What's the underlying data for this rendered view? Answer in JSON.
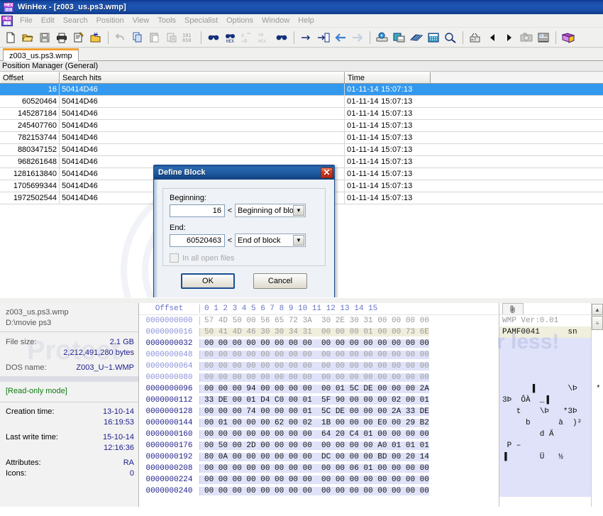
{
  "window": {
    "title": "WinHex - [z003_us.ps3.wmp]",
    "app_icon": "hex-app-icon"
  },
  "menu": {
    "items": [
      "File",
      "Edit",
      "Search",
      "Position",
      "View",
      "Tools",
      "Specialist",
      "Options",
      "Window",
      "Help"
    ]
  },
  "toolbar": {
    "groups": [
      [
        "new-file-icon",
        "open-folder-icon",
        "save-disk-icon",
        "print-icon",
        "properties-icon",
        "open-disk-icon"
      ],
      [
        "undo-icon",
        "copy-icon",
        "paste-icon",
        "clipboard-data-icon",
        "binary-101-icon"
      ],
      [
        "find-text-icon",
        "find-hex-icon",
        "replace-text-icon",
        "replace-hex-icon",
        "find-all-icon"
      ],
      [
        "goto-icon",
        "goto-file-icon",
        "back-arrow-icon",
        "forward-arrow-icon"
      ],
      [
        "open-disk-edit-icon",
        "save-backup-icon",
        "ram-editor-icon",
        "calculator-icon",
        "analyze-icon"
      ],
      [
        "checksum-icon",
        "prev-icon",
        "next-icon",
        "snapshot-icon",
        "report-icon"
      ],
      [
        "help-book-icon"
      ]
    ]
  },
  "document_tab": {
    "label": "z003_us.ps3.wmp"
  },
  "position_manager": {
    "title": "Position Manager (General)",
    "columns": [
      "Offset",
      "Search hits",
      "Time"
    ],
    "rows": [
      {
        "offset": "16",
        "hit": "50414D46",
        "time": "01-11-14  15:07:13",
        "selected": true
      },
      {
        "offset": "60520464",
        "hit": "50414D46",
        "time": "01-11-14  15:07:13",
        "selected": false
      },
      {
        "offset": "145287184",
        "hit": "50414D46",
        "time": "01-11-14  15:07:13",
        "selected": false
      },
      {
        "offset": "245407760",
        "hit": "50414D46",
        "time": "01-11-14  15:07:13",
        "selected": false
      },
      {
        "offset": "782153744",
        "hit": "50414D46",
        "time": "01-11-14  15:07:13",
        "selected": false
      },
      {
        "offset": "880347152",
        "hit": "50414D46",
        "time": "01-11-14  15:07:13",
        "selected": false
      },
      {
        "offset": "968261648",
        "hit": "50414D46",
        "time": "01-11-14  15:07:13",
        "selected": false
      },
      {
        "offset": "1281613840",
        "hit": "50414D46",
        "time": "01-11-14  15:07:13",
        "selected": false
      },
      {
        "offset": "1705699344",
        "hit": "50414D46",
        "time": "01-11-14  15:07:13",
        "selected": false
      },
      {
        "offset": "1972502544",
        "hit": "50414D46",
        "time": "01-11-14  15:07:13",
        "selected": false
      }
    ]
  },
  "dialog": {
    "title": "Define Block",
    "close_glyph": "✕",
    "beginning_label": "Beginning:",
    "beginning_value": "16",
    "beginning_relation": "<",
    "beginning_mode": "Beginning of bloc",
    "end_label": "End:",
    "end_value": "60520463",
    "end_relation": "<",
    "end_mode": "End of block",
    "checkbox_label": "In all open files",
    "checkbox_checked": false,
    "ok_label": "OK",
    "cancel_label": "Cancel",
    "caret_glyph": "▼"
  },
  "info_panel": {
    "file_name": "z003_us.ps3.wmp",
    "file_path": "D:\\movie ps3",
    "file_size_label": "File size:",
    "file_size_value": "2.1 GB",
    "file_size_bytes": "2,212,491,280 bytes",
    "dos_name_label": "DOS name:",
    "dos_name_value": "Z003_U~1.WMP",
    "mode": "[Read-only mode]",
    "creation_label": "Creation time:",
    "creation_date": "13-10-14",
    "creation_time": "16:19:53",
    "lastwrite_label": "Last write time:",
    "lastwrite_date": "15-10-14",
    "lastwrite_time": "12:16:36",
    "attributes_label": "Attributes:",
    "attributes_value": "RA",
    "icons_label": "Icons:",
    "icons_value": "0"
  },
  "hex_view": {
    "offset_header": "Offset",
    "column_header": " 0  1  2  3  4  5  6  7   8  9 10 11 12 13 14 15",
    "ascii_tab_icon": "paperclip-icon",
    "rows": [
      {
        "offset": "0000000000",
        "hex": "57 4D 50 00 56 65 72 3A  30 2E 30 31 00 00 00 00",
        "ascii": "WMP Ver:0.01",
        "style": "grey"
      },
      {
        "offset": "0000000016",
        "hex": "50 41 4D 46 30 30 34 31  00 00 00 01 00 00 73 6E",
        "ascii": "PAMF0041      sn",
        "style": "hl"
      },
      {
        "offset": "0000000032",
        "hex": "00 00 00 00 00 00 00 00  00 00 00 00 00 00 00 00",
        "ascii": "",
        "style": "dark-sel"
      },
      {
        "offset": "0000000048",
        "hex": "00 00 00 00 00 00 00 00  00 00 00 00 00 00 00 00",
        "ascii": "",
        "style": "grey-sel"
      },
      {
        "offset": "0000000064",
        "hex": "00 00 00 00 00 00 00 00  00 00 00 00 00 00 00 00",
        "ascii": "",
        "style": "grey-sel"
      },
      {
        "offset": "0000000080",
        "hex": "00 00 00 00 00 00 00 00  00 00 00 00 00 00 00 00",
        "ascii": "",
        "style": "grey-sel"
      },
      {
        "offset": "0000000096",
        "hex": "00 00 00 94 00 00 00 00  00 01 5C DE 00 00 00 2A",
        "ascii": "      ▐       \\Þ    *",
        "style": "dark-sel"
      },
      {
        "offset": "0000000112",
        "hex": "33 DE 00 01 D4 C0 00 01  5F 90 00 00 00 02 00 01",
        "ascii": "3Þ  ÔÀ  _▐",
        "style": "dark-sel"
      },
      {
        "offset": "0000000128",
        "hex": "00 00 00 74 00 00 00 01  5C DE 00 00 00 2A 33 DE",
        "ascii": "   t    \\Þ   *3Þ",
        "style": "dark-sel"
      },
      {
        "offset": "0000000144",
        "hex": "00 01 00 00 00 62 00 02  1B 00 00 00 E0 00 29 B2",
        "ascii": "     b      à  )²",
        "style": "dark-sel"
      },
      {
        "offset": "0000000160",
        "hex": "00 00 00 00 00 00 00 00  64 20 C4 01 00 00 00 00",
        "ascii": "        d Ä",
        "style": "dark-sel"
      },
      {
        "offset": "0000000176",
        "hex": "00 50 00 2D 00 00 00 00  00 00 00 00 A0 01 01 01",
        "ascii": " P –",
        "style": "dark-sel"
      },
      {
        "offset": "0000000192",
        "hex": "80 0A 00 00 00 00 00 00  DC 00 00 00 BD 00 20 14",
        "ascii": "▐       Ü   ½",
        "style": "dark-sel"
      },
      {
        "offset": "0000000208",
        "hex": "00 00 00 00 00 00 00 00  00 00 06 01 00 00 00 00",
        "ascii": "",
        "style": "dark-sel"
      },
      {
        "offset": "0000000224",
        "hex": "00 00 00 00 00 00 00 00  00 00 00 00 00 00 00 00",
        "ascii": "",
        "style": "dark-sel"
      },
      {
        "offset": "0000000240",
        "hex": "00 00 00 00 00 00 00 00  00 00 00 00 00 00 00 00",
        "ascii": "",
        "style": "dark-sel"
      }
    ]
  },
  "scrollbar": {
    "up_glyph": "▲",
    "thumb_glyph": "≡"
  },
  "watermarks": {
    "text1": "Protect",
    "text2": "r less!"
  },
  "colors": {
    "title_blue": "#1e55b4",
    "selection_blue": "#3399ee",
    "tab_accent": "#f0a030",
    "readonly_green": "#107a10",
    "hex_offset_blue": "#20208c"
  }
}
